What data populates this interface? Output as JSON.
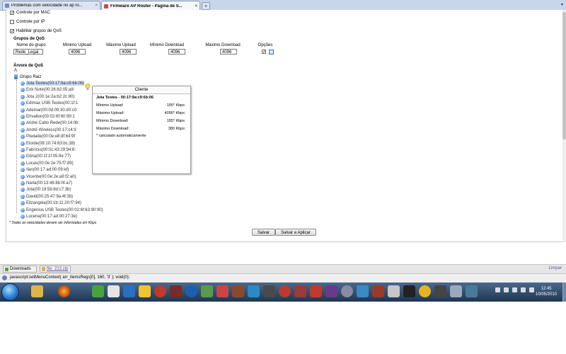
{
  "browser": {
    "tabs": [
      {
        "title": "Problemas com velocidade no ap ro...",
        "close": "×",
        "active": false
      },
      {
        "title": "Firmware AP Router - Página de S...",
        "close": "×",
        "active": true
      }
    ],
    "new_tab": "+",
    "tab_list": "▾"
  },
  "settings": {
    "mac_control": {
      "label": "Controle por MAC",
      "checked": true
    },
    "ip_control": {
      "label": "Controle por IP",
      "checked": false
    },
    "qos_enable": {
      "label": "Habilitar grupos de QoS",
      "checked": true
    },
    "groups_heading": "Grupos de QoS",
    "columns": [
      "Nome do grupo",
      "Mínimo Upload",
      "Máximo Upload",
      "Mínimo Download",
      "Máximo Download",
      "Opções"
    ],
    "group_row": {
      "name": "Rede_Legal",
      "min_upload": "4096",
      "max_upload": "4096",
      "min_download": "4096",
      "max_download": "4096"
    }
  },
  "tree": {
    "heading": "Árvore de QoS",
    "collapse_symbol": "Λ",
    "root": "Grupo Raiz",
    "clients": [
      "Jota Testes(00:17:9a:c9:6b:06)",
      "Erik Note(00:26:82:05:a9:",
      "Jota 2(00:1e:2a:b2:2c:80)",
      "Edimax USB Testes(00:1f:1",
      "Ademar(00:0d:09:30:d0:c0",
      "Erivalton(00:02:6f:60:99:1",
      "André Cabo Rede(00:14:0b:",
      "André Wireless(00:17:c4:9",
      "Piedade(00:0e:e8:df:64:9f",
      "Eloíde(08:10:74:63:bc:38)",
      "Fabrício(00:0c:43:29:94:6:",
      "Edna(00:1f:1f:05:8e:77)",
      "Lucas(00:0e:2e:75:f7:89)",
      "Ilan(00:17:ad:00:09:ef)",
      "Vicente(00:0e:2e:a9:f2:a0)",
      "Narla(00:13:46:8b:f4:a7)",
      "Jota(00:19:5b:8d:c7:3b)",
      "David(00:25:47:9a:4f:3b)",
      "Elizangela(00:1b:11:20:f7:94)",
      "Engenius USB Testes(00:02:6f:63:90:90)",
      "Lucena(00:17:ad:00:27:3e)"
    ]
  },
  "popup": {
    "title": "Cliente",
    "client": "Jota Testes - 00:17:9a:c9:6b:06",
    "rows": [
      {
        "label": "Mínimo Upload:",
        "value": "195* Kbps"
      },
      {
        "label": "Máximo Upload:",
        "value": "4096* Kbps"
      },
      {
        "label": "Mínimo Download:",
        "value": "195* Kbps"
      },
      {
        "label": "Máximo Download:",
        "value": "380 Kbps"
      }
    ],
    "note": "* calculado automaticamente"
  },
  "footer": {
    "note": "* Todas as velocidades devem ser informadas em Kbps",
    "save": "Salvar",
    "save_apply": "Salvar e Aplicar"
  },
  "downloads_bar": {
    "downloads": "Downloads",
    "file": "file_213.zip",
    "clear": "Limpar"
  },
  "status": {
    "url": "javascript:setMenuContext( arr_itemsRegs[0], 160, '3' ); void(0);"
  },
  "taskbar": {
    "time": "12:45",
    "date": "10/05/2010"
  }
}
